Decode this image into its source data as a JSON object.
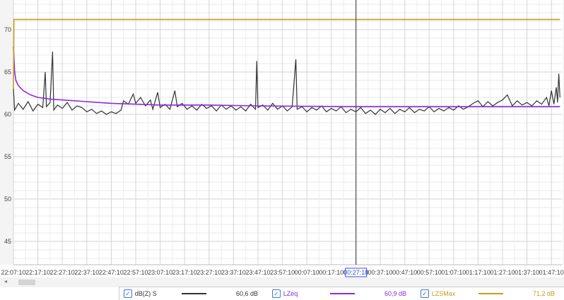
{
  "chart_data": {
    "type": "line",
    "xlabel": "",
    "ylabel": "",
    "x_unit": "minutes since 22:07:10",
    "xlim": [
      0,
      226
    ],
    "ylim": [
      42.25,
      73.5
    ],
    "y_ticks": [
      45,
      50,
      55,
      60,
      65,
      70
    ],
    "x_tick_labels": [
      "22:07:10",
      "22:17:10",
      "22:27:10",
      "22:37:10",
      "22:47:10",
      "22:57:10",
      "23:07:10",
      "23:17:10",
      "23:27:10",
      "23:37:10",
      "23:47:10",
      "23:57:10",
      "00:07:10",
      "00:17:10",
      "00:27:10",
      "00:37:10",
      "00:47:10",
      "00:57:10",
      "01:07:10",
      "01:17:10",
      "01:27:10",
      "01:37:10",
      "01:47:10"
    ],
    "cursor": {
      "label": "00:27:18",
      "x": 140.1
    },
    "grid": true,
    "series": [
      {
        "name": "dB(Z) S",
        "color": "#333333",
        "summary": "60,6 dB",
        "points": [
          [
            0,
            63
          ],
          [
            0.5,
            60.5
          ],
          [
            2,
            61.3
          ],
          [
            4,
            60.6
          ],
          [
            6,
            61.5
          ],
          [
            8,
            60.4
          ],
          [
            10,
            61.2
          ],
          [
            12,
            60.8
          ],
          [
            13,
            65
          ],
          [
            13.5,
            60.9
          ],
          [
            15,
            61.4
          ],
          [
            16,
            67.4
          ],
          [
            16.5,
            60.5
          ],
          [
            18,
            61.1
          ],
          [
            20,
            60.7
          ],
          [
            22,
            61.4
          ],
          [
            24,
            60.5
          ],
          [
            26,
            61
          ],
          [
            28,
            60.8
          ],
          [
            30,
            60.3
          ],
          [
            32,
            60.6
          ],
          [
            34,
            60.1
          ],
          [
            36,
            60.4
          ],
          [
            38,
            60
          ],
          [
            40,
            60.3
          ],
          [
            42,
            60.1
          ],
          [
            44,
            60.5
          ],
          [
            45,
            61.6
          ],
          [
            47,
            61.2
          ],
          [
            49,
            62.4
          ],
          [
            50,
            61.3
          ],
          [
            52,
            62
          ],
          [
            54,
            61
          ],
          [
            56,
            61.7
          ],
          [
            57,
            60.6
          ],
          [
            59,
            62.6
          ],
          [
            60,
            60.8
          ],
          [
            62,
            61.2
          ],
          [
            64,
            60.6
          ],
          [
            66,
            62.8
          ],
          [
            67,
            60.9
          ],
          [
            69,
            61.3
          ],
          [
            71,
            60.6
          ],
          [
            73,
            61
          ],
          [
            75,
            60.5
          ],
          [
            77,
            61.2
          ],
          [
            79,
            60.7
          ],
          [
            81,
            61
          ],
          [
            83,
            60.4
          ],
          [
            85,
            61.1
          ],
          [
            87,
            60.6
          ],
          [
            89,
            61
          ],
          [
            91,
            60.5
          ],
          [
            93,
            60.9
          ],
          [
            95,
            60.4
          ],
          [
            97,
            61.2
          ],
          [
            99,
            60.6
          ],
          [
            99.5,
            66.3
          ],
          [
            100,
            60.8
          ],
          [
            102,
            61.1
          ],
          [
            104,
            60.5
          ],
          [
            106,
            61.3
          ],
          [
            108,
            60.6
          ],
          [
            110,
            61
          ],
          [
            112,
            60.4
          ],
          [
            114,
            60.9
          ],
          [
            115.5,
            66.5
          ],
          [
            116,
            60.6
          ],
          [
            118,
            60.9
          ],
          [
            120,
            60.3
          ],
          [
            122,
            60.8
          ],
          [
            124,
            60.5
          ],
          [
            126,
            61
          ],
          [
            128,
            60.3
          ],
          [
            130,
            60.7
          ],
          [
            132,
            60.4
          ],
          [
            134,
            60.9
          ],
          [
            136,
            60.2
          ],
          [
            138,
            60.6
          ],
          [
            140,
            60.3
          ],
          [
            142,
            60.8
          ],
          [
            144,
            60.1
          ],
          [
            146,
            60.5
          ],
          [
            148,
            60
          ],
          [
            150,
            60.6
          ],
          [
            152,
            60.2
          ],
          [
            154,
            60.7
          ],
          [
            156,
            60.1
          ],
          [
            158,
            60.6
          ],
          [
            160,
            60.3
          ],
          [
            162,
            60.8
          ],
          [
            164,
            60.2
          ],
          [
            166,
            60.6
          ],
          [
            168,
            60.4
          ],
          [
            170,
            60.9
          ],
          [
            172,
            60.3
          ],
          [
            174,
            60.7
          ],
          [
            176,
            60.4
          ],
          [
            178,
            60.8
          ],
          [
            180,
            60.5
          ],
          [
            182,
            61
          ],
          [
            184,
            60.6
          ],
          [
            186,
            60.9
          ],
          [
            188,
            61.3
          ],
          [
            190,
            61.6
          ],
          [
            192,
            60.9
          ],
          [
            194,
            61.5
          ],
          [
            196,
            61
          ],
          [
            198,
            61.4
          ],
          [
            200,
            61.7
          ],
          [
            202,
            62.3
          ],
          [
            204,
            61
          ],
          [
            206,
            61.6
          ],
          [
            208,
            61.1
          ],
          [
            210,
            61.4
          ],
          [
            212,
            61
          ],
          [
            214,
            61.6
          ],
          [
            216,
            61.2
          ],
          [
            218,
            62
          ],
          [
            219,
            61
          ],
          [
            220,
            62.8
          ],
          [
            221,
            61.2
          ],
          [
            222,
            63.2
          ],
          [
            222.5,
            61.4
          ],
          [
            223,
            64.8
          ],
          [
            223.5,
            62
          ]
        ]
      },
      {
        "name": "LZeq",
        "color": "#8a2be2",
        "summary": "60,9 dB",
        "points": [
          [
            0,
            68
          ],
          [
            0.5,
            65
          ],
          [
            1,
            64
          ],
          [
            2,
            63.4
          ],
          [
            4,
            62.8
          ],
          [
            7,
            62.3
          ],
          [
            10,
            62
          ],
          [
            15,
            61.8
          ],
          [
            20,
            61.7
          ],
          [
            30,
            61.5
          ],
          [
            40,
            61.3
          ],
          [
            50,
            61.2
          ],
          [
            60,
            61.1
          ],
          [
            80,
            61.1
          ],
          [
            100,
            61
          ],
          [
            140,
            60.9
          ],
          [
            180,
            60.9
          ],
          [
            223.5,
            60.9
          ]
        ]
      },
      {
        "name": "LZSMax",
        "color": "#c89b1a",
        "summary": "71,2 dB",
        "points": [
          [
            0,
            63
          ],
          [
            0.2,
            71.2
          ],
          [
            223.5,
            71.2
          ]
        ]
      }
    ]
  },
  "legend": [
    {
      "label": "dB(Z) S",
      "value": "60,6 dB",
      "checked": "✓"
    },
    {
      "label": "LZeq",
      "value": "60,9 dB",
      "checked": "✓"
    },
    {
      "label": "LZSMax",
      "value": "71,2 dB",
      "checked": "✓"
    }
  ],
  "scrollbar": {
    "left_arrow": "◂"
  }
}
